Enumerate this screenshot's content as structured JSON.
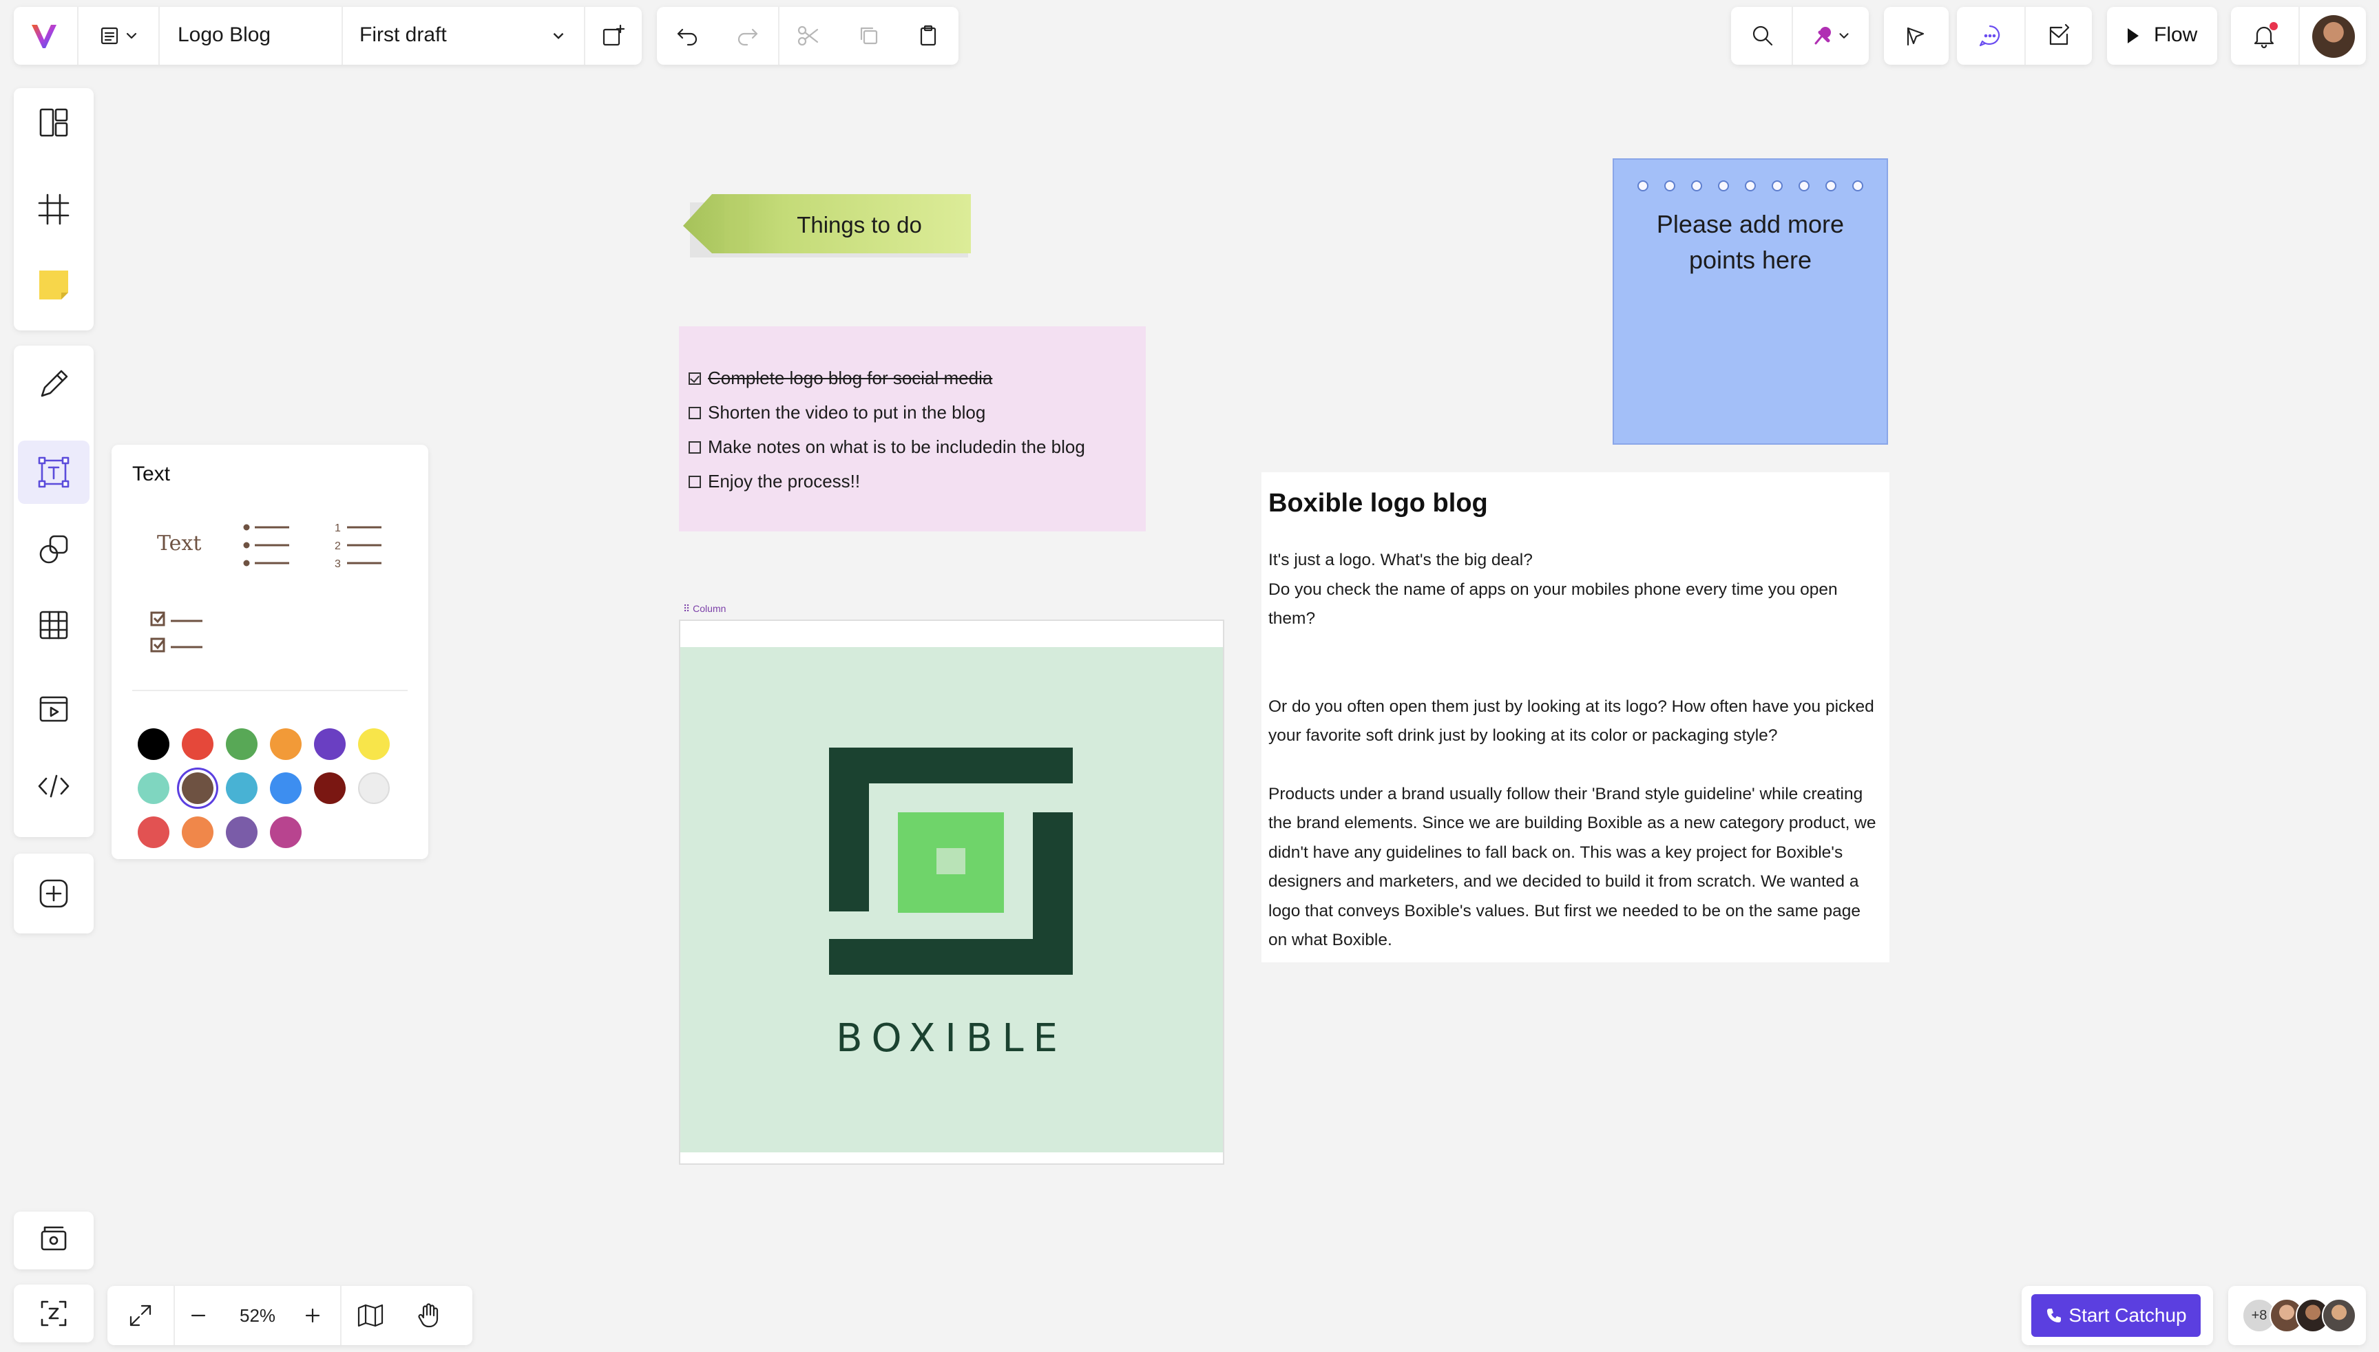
{
  "topbar": {
    "document_title": "Logo Blog",
    "draft_name": "First draft",
    "flow_label": "Flow"
  },
  "text_panel": {
    "title": "Text",
    "text_option_label": "Text",
    "colors": [
      "#000000",
      "#e5483a",
      "#58a856",
      "#f29a38",
      "#6a3fc2",
      "#f8e54a",
      "#7fd6c0",
      "#6e5242",
      "#48b2d4",
      "#3d8ef0",
      "#7a1712",
      "#ededed",
      "#e25252",
      "#f0874a",
      "#7a5ca8",
      "#b8448f"
    ],
    "selected_color": "#6e5242"
  },
  "canvas": {
    "tag_label": "Things to do",
    "todo_items": [
      {
        "text": "Complete logo blog for social media",
        "done": true
      },
      {
        "text": "Shorten the video to put in the blog",
        "done": false
      },
      {
        "text": "Make notes on what is to be includedin the blog",
        "done": false
      },
      {
        "text": "Enjoy the process!!",
        "done": false
      }
    ],
    "notepad_text": "Please add more points here",
    "blog_title": "Boxible logo blog",
    "blog_paragraphs": [
      "It's just a logo. What's the big deal?",
      "Do you check the name of apps on your mobiles  phone every time you open them?",
      "Or do you often open them just by looking at its logo? How often have you picked your favorite soft drink just by looking at its color or packaging style?",
      "Products under a brand usually follow their 'Brand style guideline'  while creating the brand elements. Since we are building Boxible as a new category product, we didn't have any guidelines to fall back on. This was a key project for Boxible's designers and marketers, and we decided to build it from scratch. We wanted a logo that conveys Boxible's values. But first we needed to be on the same page on what Boxible."
    ],
    "column_label": "Column",
    "logo_wordmark": "BOXIBLE"
  },
  "bottombar": {
    "zoom": "52%",
    "start_catchup": "Start Catchup",
    "collaborators_extra": "+8"
  },
  "colors": {
    "accent": "#5b3fe0",
    "todo_bg": "#f3e0f2",
    "notepad_bg": "#a3bff8",
    "logo_bg": "#d5ebdb",
    "logo_dark": "#1b4230",
    "logo_light": "#6fd46a"
  }
}
